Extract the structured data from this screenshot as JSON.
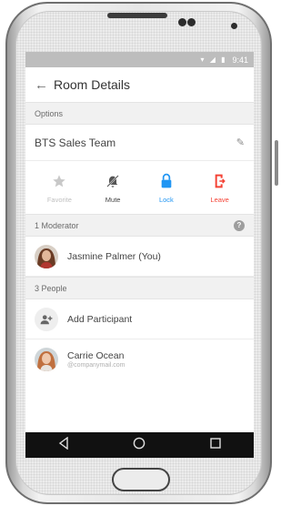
{
  "status_bar": {
    "time": "9:41",
    "icons": "▾ ◢ ▮"
  },
  "header": {
    "title": "Room Details",
    "back_icon": "back-arrow-icon"
  },
  "options": {
    "section_label": "Options",
    "room_name": "BTS Sales Team",
    "actions": [
      {
        "label": "Favorite",
        "icon": "star-icon",
        "color": "#c0c0c0"
      },
      {
        "label": "Mute",
        "icon": "mute-bell-icon",
        "color": "#444444"
      },
      {
        "label": "Lock",
        "icon": "lock-icon",
        "color": "#2196f3"
      },
      {
        "label": "Leave",
        "icon": "leave-icon",
        "color": "#f44336"
      }
    ]
  },
  "moderators": {
    "section_label": "1 Moderator",
    "help_badge": "?",
    "items": [
      {
        "name": "Jasmine Palmer",
        "suffix": "(You)"
      }
    ]
  },
  "people": {
    "section_label": "3 People",
    "add_label": "Add Participant",
    "items": [
      {
        "name": "Carrie Ocean",
        "email": "@companymail.com"
      }
    ]
  },
  "colors": {
    "accent_blue": "#2196f3",
    "danger_red": "#f44336",
    "status_gray": "#bdbdbd"
  }
}
